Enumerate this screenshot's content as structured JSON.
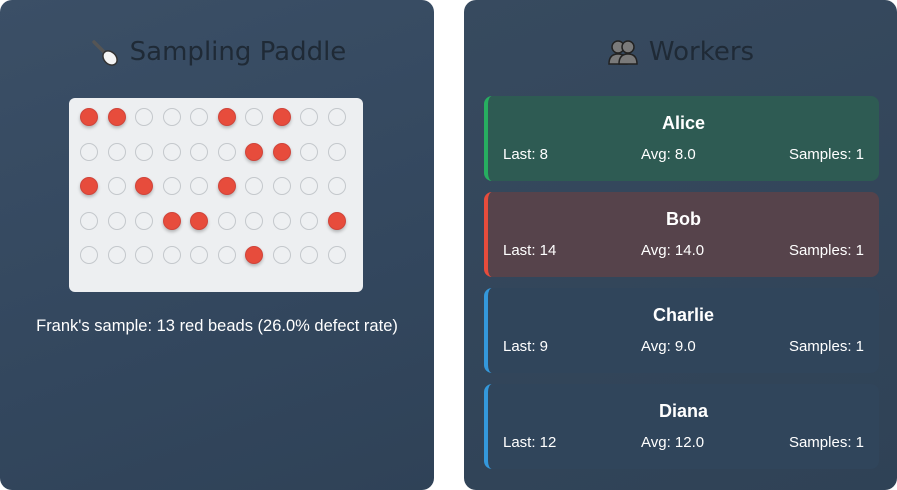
{
  "sampling": {
    "title": "Sampling Paddle",
    "icon": "spoon-icon",
    "beads": [
      [
        "red",
        "red",
        "white",
        "white",
        "white",
        "red",
        "white",
        "red",
        "white",
        "white"
      ],
      [
        "white",
        "white",
        "white",
        "white",
        "white",
        "white",
        "red",
        "red",
        "white",
        "white"
      ],
      [
        "red",
        "white",
        "red",
        "white",
        "white",
        "red",
        "white",
        "white",
        "white",
        "white"
      ],
      [
        "white",
        "white",
        "white",
        "red",
        "red",
        "white",
        "white",
        "white",
        "white",
        "red"
      ],
      [
        "white",
        "white",
        "white",
        "white",
        "white",
        "white",
        "red",
        "white",
        "white",
        "white"
      ]
    ],
    "sample_text": "Frank's sample: 13 red beads (26.0% defect rate)"
  },
  "workers": {
    "title": "Workers",
    "icon": "users-icon",
    "list": [
      {
        "name": "Alice",
        "last": "Last: 8",
        "avg": "Avg: 8.0",
        "samples": "Samples: 1",
        "status": "good"
      },
      {
        "name": "Bob",
        "last": "Last: 14",
        "avg": "Avg: 14.0",
        "samples": "Samples: 1",
        "status": "bad"
      },
      {
        "name": "Charlie",
        "last": "Last: 9",
        "avg": "Avg: 9.0",
        "samples": "Samples: 1",
        "status": "neutral"
      },
      {
        "name": "Diana",
        "last": "Last: 12",
        "avg": "Avg: 12.0",
        "samples": "Samples: 1",
        "status": "neutral"
      }
    ]
  },
  "colors": {
    "red_bead": "#e74c3c",
    "good": "#27ae60",
    "bad": "#e74c3c",
    "neutral": "#3498db"
  }
}
